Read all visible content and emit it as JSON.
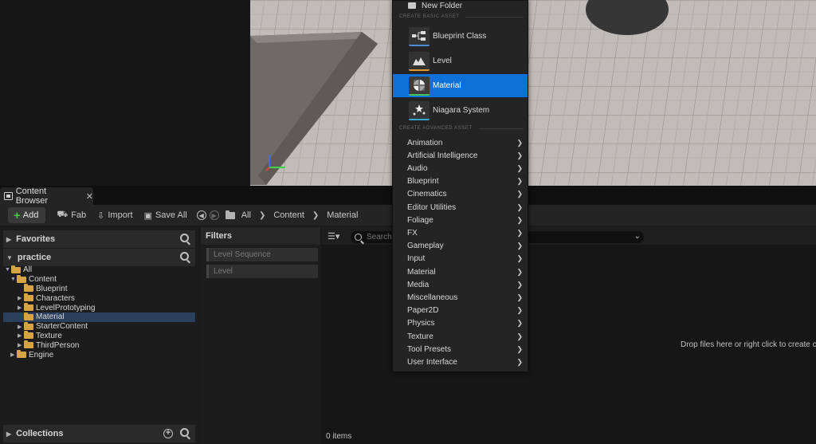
{
  "menu": {
    "new_folder": "New Folder",
    "basic_section": "CREATE BASIC ASSET",
    "basic_items": [
      {
        "label": "Blueprint Class",
        "icon": "blueprint-class-icon"
      },
      {
        "label": "Level",
        "icon": "level-icon"
      },
      {
        "label": "Material",
        "icon": "material-icon",
        "highlighted": true
      },
      {
        "label": "Niagara System",
        "icon": "niagara-system-icon"
      }
    ],
    "advanced_section": "CREATE ADVANCED ASSET",
    "advanced_items": [
      "Animation",
      "Artificial Intelligence",
      "Audio",
      "Blueprint",
      "Cinematics",
      "Editor Utilities",
      "Foliage",
      "FX",
      "Gameplay",
      "Input",
      "Material",
      "Media",
      "Miscellaneous",
      "Paper2D",
      "Physics",
      "Texture",
      "Tool Presets",
      "User Interface"
    ],
    "highlight_color": "#0e70d9"
  },
  "content_browser": {
    "tab_label": "Content Browser",
    "tab_close": "✕",
    "toolbar": {
      "add": "Add",
      "fab": "Fab",
      "import": "Import",
      "save_all": "Save All"
    },
    "breadcrumb": [
      "All",
      "Content",
      "Material"
    ],
    "favorites": "Favorites",
    "project": "practice",
    "tree": [
      {
        "label": "All",
        "depth": 0,
        "expanded": true
      },
      {
        "label": "Content",
        "depth": 1,
        "expanded": true
      },
      {
        "label": "Blueprint",
        "depth": 2
      },
      {
        "label": "Characters",
        "depth": 2,
        "has_children": true
      },
      {
        "label": "LevelPrototyping",
        "depth": 2,
        "has_children": true
      },
      {
        "label": "Material",
        "depth": 2,
        "selected": true
      },
      {
        "label": "StarterContent",
        "depth": 2,
        "has_children": true
      },
      {
        "label": "Texture",
        "depth": 2,
        "has_children": true
      },
      {
        "label": "ThirdPerson",
        "depth": 2,
        "has_children": true
      },
      {
        "label": "Engine",
        "depth": 1,
        "has_children": true
      }
    ],
    "collections": "Collections",
    "filters_title": "Filters",
    "filter_chips": [
      "Level Sequence",
      "Level"
    ],
    "search_placeholder": "Search",
    "drop_hint": "Drop files here or right click to create co",
    "items_count": "0 items"
  }
}
